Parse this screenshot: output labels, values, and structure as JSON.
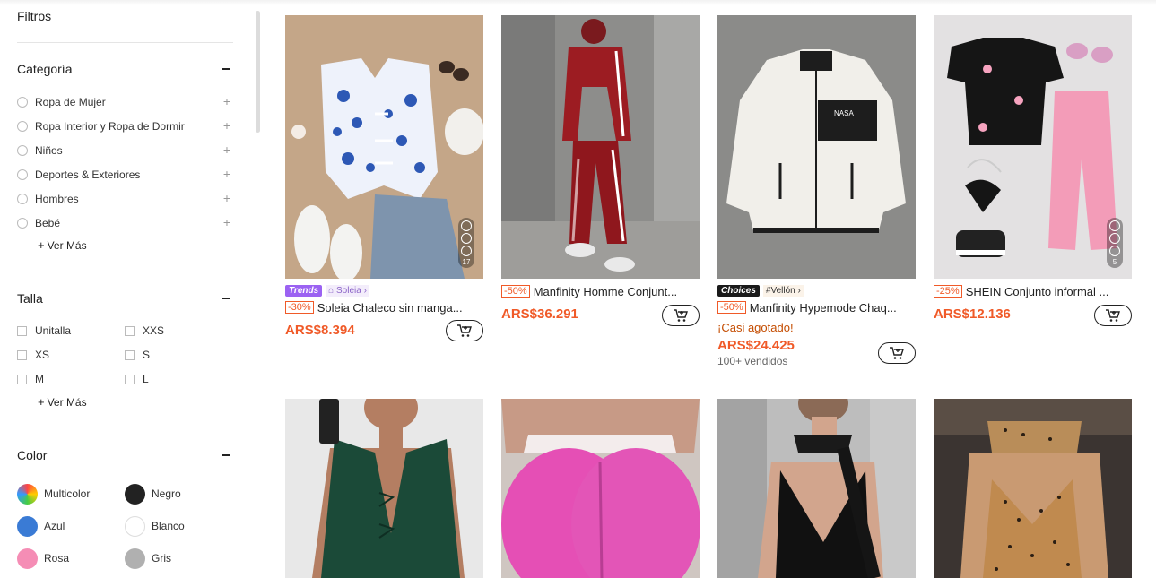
{
  "sidebar": {
    "filters_title": "Filtros",
    "category": {
      "title": "Categoría",
      "items": [
        {
          "label": "Ropa de Mujer"
        },
        {
          "label": "Ropa Interior y Ropa de Dormir"
        },
        {
          "label": "Niños"
        },
        {
          "label": "Deportes & Exteriores"
        },
        {
          "label": "Hombres"
        },
        {
          "label": "Bebé"
        }
      ],
      "see_more": "Ver Más"
    },
    "size": {
      "title": "Talla",
      "items": [
        "Unitalla",
        "XXS",
        "XS",
        "S",
        "M",
        "L"
      ],
      "see_more": "Ver Más"
    },
    "color": {
      "title": "Color",
      "items": [
        {
          "label": "Multicolor",
          "color": "multicolor"
        },
        {
          "label": "Negro",
          "color": "#222222"
        },
        {
          "label": "Azul",
          "color": "#3a7bd5"
        },
        {
          "label": "Blanco",
          "color": "#ffffff"
        },
        {
          "label": "Rosa",
          "color": "#f58db5"
        },
        {
          "label": "Gris",
          "color": "#b0b0b0"
        }
      ]
    }
  },
  "products": [
    {
      "badge_trends": "Trends",
      "badge_store": "Soleia",
      "discount": "-30%",
      "title": "Soleia Chaleco sin manga...",
      "price": "ARS$8.394",
      "image_count": "17"
    },
    {
      "discount": "-50%",
      "title": "Manfinity Homme Conjunt...",
      "price": "ARS$36.291"
    },
    {
      "badge_choices": "Choices",
      "badge_store": "#Vellón",
      "discount": "-50%",
      "title": "Manfinity Hypemode Chaq...",
      "soldout": "¡Casi agotado!",
      "price": "ARS$24.425",
      "sold": "100+ vendidos"
    },
    {
      "discount": "-25%",
      "title": "SHEIN Conjunto informal ...",
      "price": "ARS$12.136",
      "image_count": "5"
    }
  ],
  "accent_color": "#f05a28"
}
